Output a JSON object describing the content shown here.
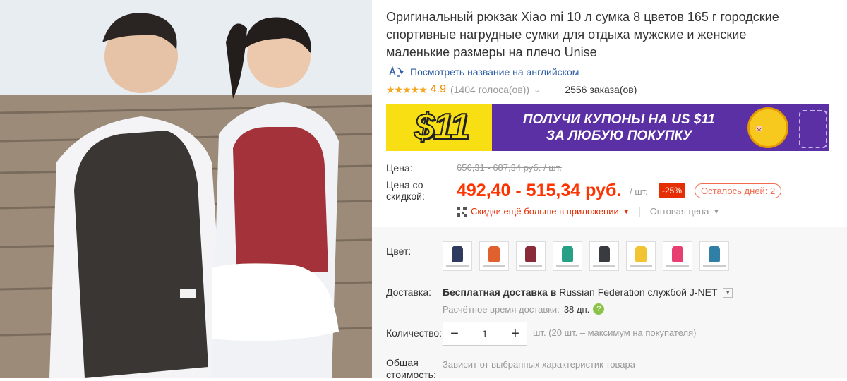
{
  "product": {
    "title": "Оригинальный рюкзак Xiao mi 10 л сумка 8 цветов 165 г городские спортивные нагрудные сумки для отдыха мужские и женские маленькие размеры на плечо Unise",
    "translate_link": "Посмотреть название на английском",
    "rating_score": "4.9",
    "votes": "(1404 голоса(ов))",
    "orders": "2556 заказа(ов)"
  },
  "banner": {
    "amount": "$11",
    "line1": "ПОЛУЧИ КУПОНЫ НА US $11",
    "line2": "ЗА ЛЮБУЮ ПОКУПКУ"
  },
  "price": {
    "label_price": "Цена:",
    "old": "656,31 - 687,34 руб. / шт.",
    "label_discount": "Цена со скидкой:",
    "new": "492,40 - 515,34 руб.",
    "per_unit": "/ шт.",
    "discount_badge": "-25%",
    "days_left": "Осталось дней: 2",
    "app_discount": "Скидки ещё больше в приложении",
    "wholesale": "Оптовая цена"
  },
  "options": {
    "color_label": "Цвет:",
    "colors": [
      "#2f3b5e",
      "#e0612e",
      "#8a2b3a",
      "#27a085",
      "#3a3b40",
      "#f2c432",
      "#e83f73",
      "#2f7fa6"
    ],
    "shipping_label": "Доставка:",
    "shipping_free": "Бесплатная доставка в",
    "shipping_country": "Russian Federation службой J-NET",
    "delivery_time_label": "Расчётное время доставки:",
    "delivery_time": "38 дн.",
    "quantity_label": "Количество:",
    "quantity_value": "1",
    "quantity_note": "шт. (20 шт. – максимум на покупателя)",
    "total_label": "Общая стоимость:",
    "total_note": "Зависит от выбранных характеристик товара"
  }
}
